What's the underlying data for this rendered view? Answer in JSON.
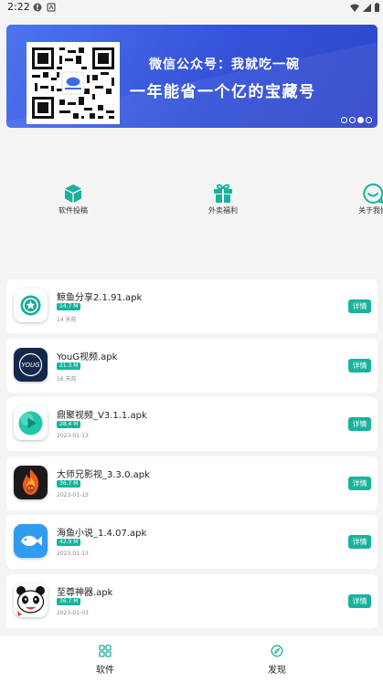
{
  "status_bar": {
    "time": "2:22"
  },
  "banner": {
    "line1": "微信公众号：我就吃一碗",
    "line2": "一年能省一个亿的宝藏号",
    "page_count": 4,
    "active_page": 3
  },
  "shortcuts": [
    {
      "label": "软件投稿",
      "icon": "cube-icon"
    },
    {
      "label": "外卖福利",
      "icon": "gift-icon"
    },
    {
      "label": "关于我们",
      "icon": "smile-chat-icon"
    }
  ],
  "apps": [
    {
      "name": "鲸鱼分享2.1.91.apk",
      "size": "14.7 M",
      "date": "14 天前",
      "detail": "详情",
      "icon": "star-badge-icon"
    },
    {
      "name": "YouG视频.apk",
      "size": "21.3 M",
      "date": "16 天前",
      "detail": "详情",
      "icon": "youg-logo"
    },
    {
      "name": "鼎聚视频_V3.1.1.apk",
      "size": "28.4 M",
      "date": "2023-01-13",
      "detail": "详情",
      "icon": "play-ball-icon"
    },
    {
      "name": "大师兄影视_3.3.0.apk",
      "size": "36.7 M",
      "date": "2023-01-13",
      "detail": "详情",
      "icon": "fire-monkey-icon"
    },
    {
      "name": "海鱼小说_1.4.07.apk",
      "size": "42.9 M",
      "date": "2023-01-13",
      "detail": "详情",
      "icon": "fish-icon"
    },
    {
      "name": "至尊神器.apk",
      "size": "36.7 M",
      "date": "2023-01-03",
      "detail": "详情",
      "icon": "panda-icon"
    }
  ],
  "tabbar": [
    {
      "label": "软件",
      "icon": "grid-icon",
      "active": true
    },
    {
      "label": "发现",
      "icon": "compass-icon",
      "active": false
    }
  ],
  "colors": {
    "accent": "#17b39c",
    "banner": "#3a5ce0",
    "background": "#f4f4f4"
  }
}
